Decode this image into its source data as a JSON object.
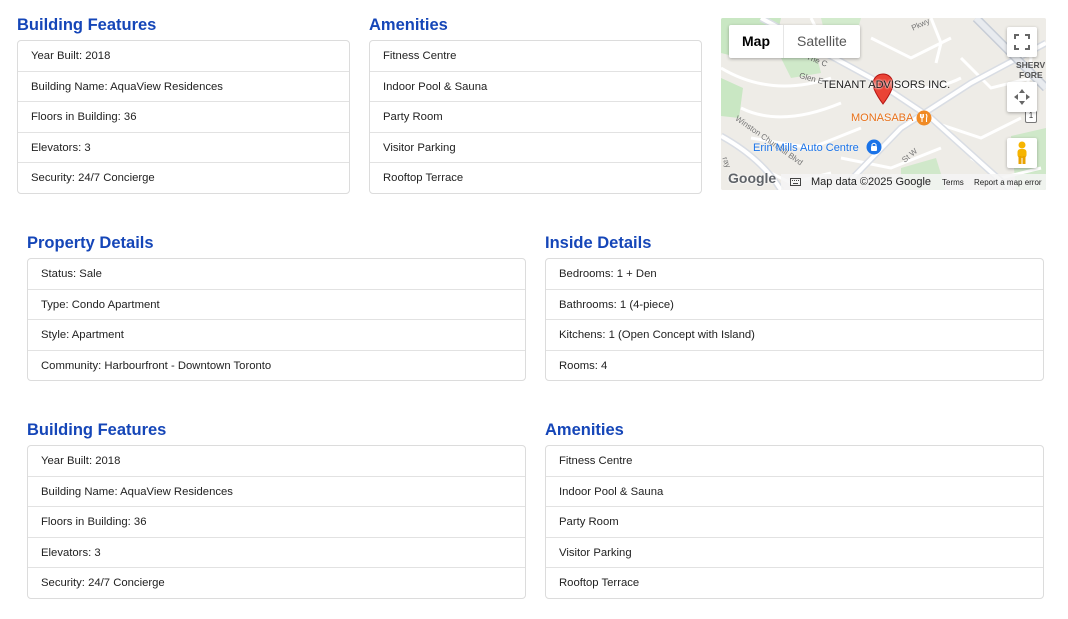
{
  "top": {
    "building_features": {
      "title": "Building Features",
      "rows": [
        "Year Built: 2018",
        "Building Name: AquaView Residences",
        "Floors in Building: 36",
        "Elevators: 3",
        "Security: 24/7 Concierge"
      ]
    },
    "amenities": {
      "title": "Amenities",
      "rows": [
        "Fitness Centre",
        "Indoor Pool & Sauna",
        "Party Room",
        "Visitor Parking",
        "Rooftop Terrace"
      ]
    }
  },
  "map": {
    "type_map": "Map",
    "type_satellite": "Satellite",
    "icons": [
      "fullscreen-icon",
      "pan-control-icon",
      "street-view-pegman-icon",
      "map-pin-icon",
      "keyboard-icon"
    ],
    "pin_label": "TENANT ADVISORS INC.",
    "poi_restaurant": "MONASABA",
    "poi_auto": "Erin Mills Auto Centre",
    "street_labels": [
      "The C",
      "Glen E",
      "Winston Churchill Blvd",
      "St W",
      "Pkwy",
      "ray"
    ],
    "corner_label_1": "SHERV",
    "corner_label_2": "FORE",
    "route_shield": "1",
    "logo": "Google",
    "data_text": "Map data ©2025 Google",
    "terms": "Terms",
    "report": "Report a map error",
    "colors": {
      "pin": "#e53935",
      "poi_orange": "#e8711a",
      "poi_blue": "#1a73e8",
      "park": "#c8e6c0",
      "road": "#ffffff"
    }
  },
  "property_details": {
    "title": "Property Details",
    "rows": [
      "Status: Sale",
      "Type: Condo Apartment",
      "Style: Apartment",
      "Community: Harbourfront - Downtown Toronto"
    ]
  },
  "inside_details": {
    "title": "Inside Details",
    "rows": [
      "Bedrooms: 1 + Den",
      "Bathrooms: 1 (4-piece)",
      "Kitchens: 1 (Open Concept with Island)",
      "Rooms: 4"
    ]
  },
  "bottom": {
    "building_features": {
      "title": "Building Features",
      "rows": [
        "Year Built: 2018",
        "Building Name: AquaView Residences",
        "Floors in Building: 36",
        "Elevators: 3",
        "Security: 24/7 Concierge"
      ]
    },
    "amenities": {
      "title": "Amenities",
      "rows": [
        "Fitness Centre",
        "Indoor Pool & Sauna",
        "Party Room",
        "Visitor Parking",
        "Rooftop Terrace"
      ]
    }
  },
  "theme": {
    "heading_color": "#1546b8",
    "border_color": "#dcdcdc"
  }
}
